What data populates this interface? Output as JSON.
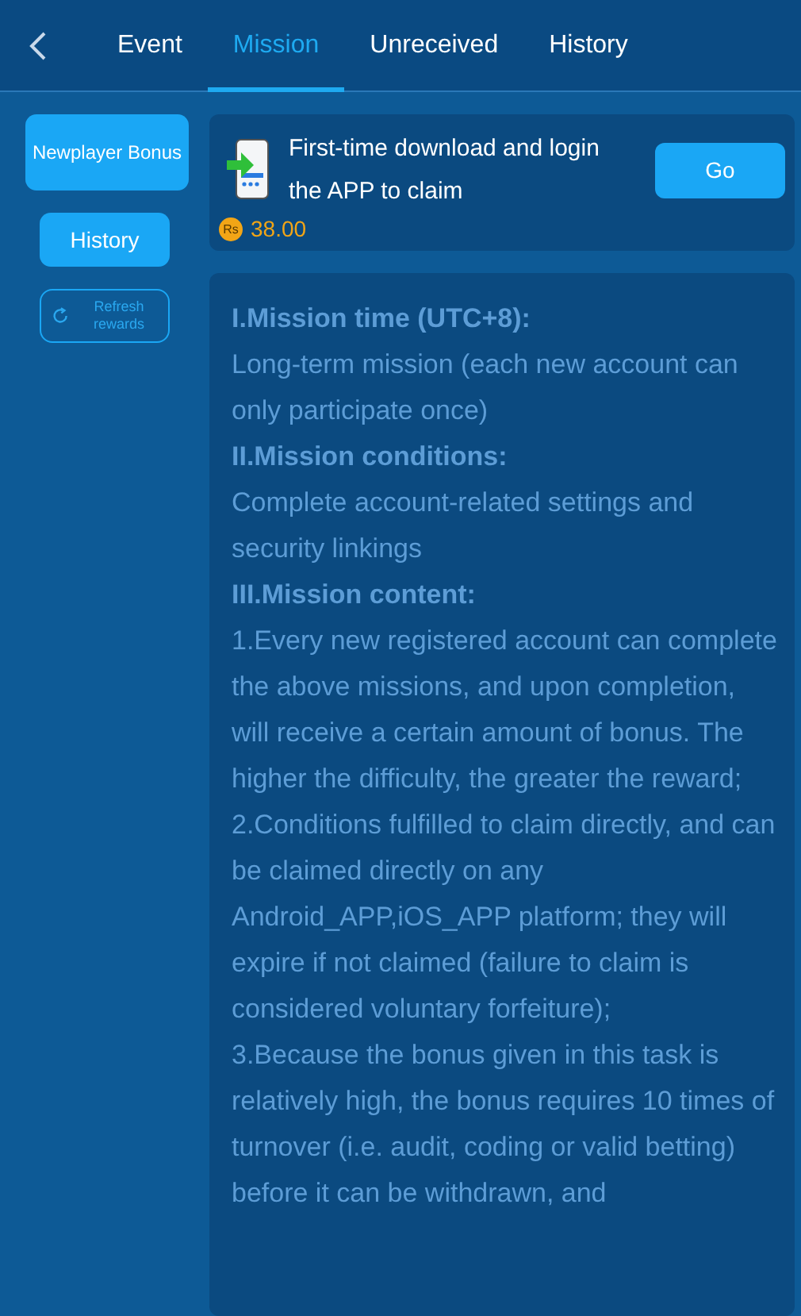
{
  "tabs": [
    {
      "label": "Event",
      "selected": false
    },
    {
      "label": "Mission",
      "selected": true
    },
    {
      "label": "Unreceived",
      "selected": false
    },
    {
      "label": "History",
      "selected": false
    }
  ],
  "sidebar": {
    "items": [
      {
        "label": "Newplayer Bonus",
        "kind": "category",
        "selected": true
      },
      {
        "label": "History",
        "kind": "button",
        "selected": false
      },
      {
        "label": "Refresh rewards",
        "kind": "refresh",
        "selected": false
      }
    ]
  },
  "mission": {
    "title": "First-time download and login the APP to claim",
    "currency": "Rs",
    "reward": "38.00",
    "button": "Go"
  },
  "rules": [
    {
      "kind": "heading",
      "text": "I.Mission time (UTC+8):"
    },
    {
      "kind": "text",
      "text": "Long-term mission (each new account can only participate once)"
    },
    {
      "kind": "heading",
      "text": "II.Mission conditions:"
    },
    {
      "kind": "text",
      "text": "Complete account-related settings and security linkings"
    },
    {
      "kind": "heading",
      "text": "III.Mission content:"
    },
    {
      "kind": "text",
      "text": "1.Every new registered account can complete the above missions, and upon completion, will receive a certain amount of bonus. The higher the difficulty, the greater the reward;"
    },
    {
      "kind": "text",
      "text": "2.Conditions fulfilled to claim directly, and can be claimed directly on any Android_APP,iOS_APP platform; they will expire if not claimed (failure to claim is considered voluntary forfeiture);"
    },
    {
      "kind": "text",
      "text": "3.Because the bonus given in this task is relatively high, the bonus requires 10 times of turnover (i.e. audit, coding or valid betting) before it can be withdrawn, and"
    }
  ]
}
